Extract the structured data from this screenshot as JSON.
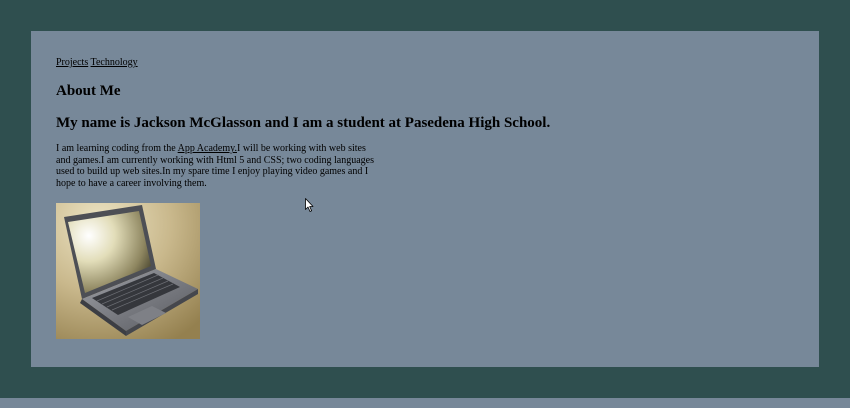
{
  "nav": {
    "projects_label": "Projects",
    "technology_label": "Technology"
  },
  "headings": {
    "about": "About Me",
    "intro": "My name is Jackson McGlasson and I am a student at Pasedena High School."
  },
  "bio": {
    "before_link": "I am learning coding from the ",
    "link_text": "App Academy.",
    "after_link": "I will be working with web sites and games.I am currently working with Html 5 and CSS; two coding languages used to build up web sites.In my spare time I enjoy playing video games and I hope to have a career involving them."
  },
  "image": {
    "subject": "laptop-photo"
  },
  "colors": {
    "outer_background": "#2f4f4f",
    "panel_background": "#778899"
  }
}
